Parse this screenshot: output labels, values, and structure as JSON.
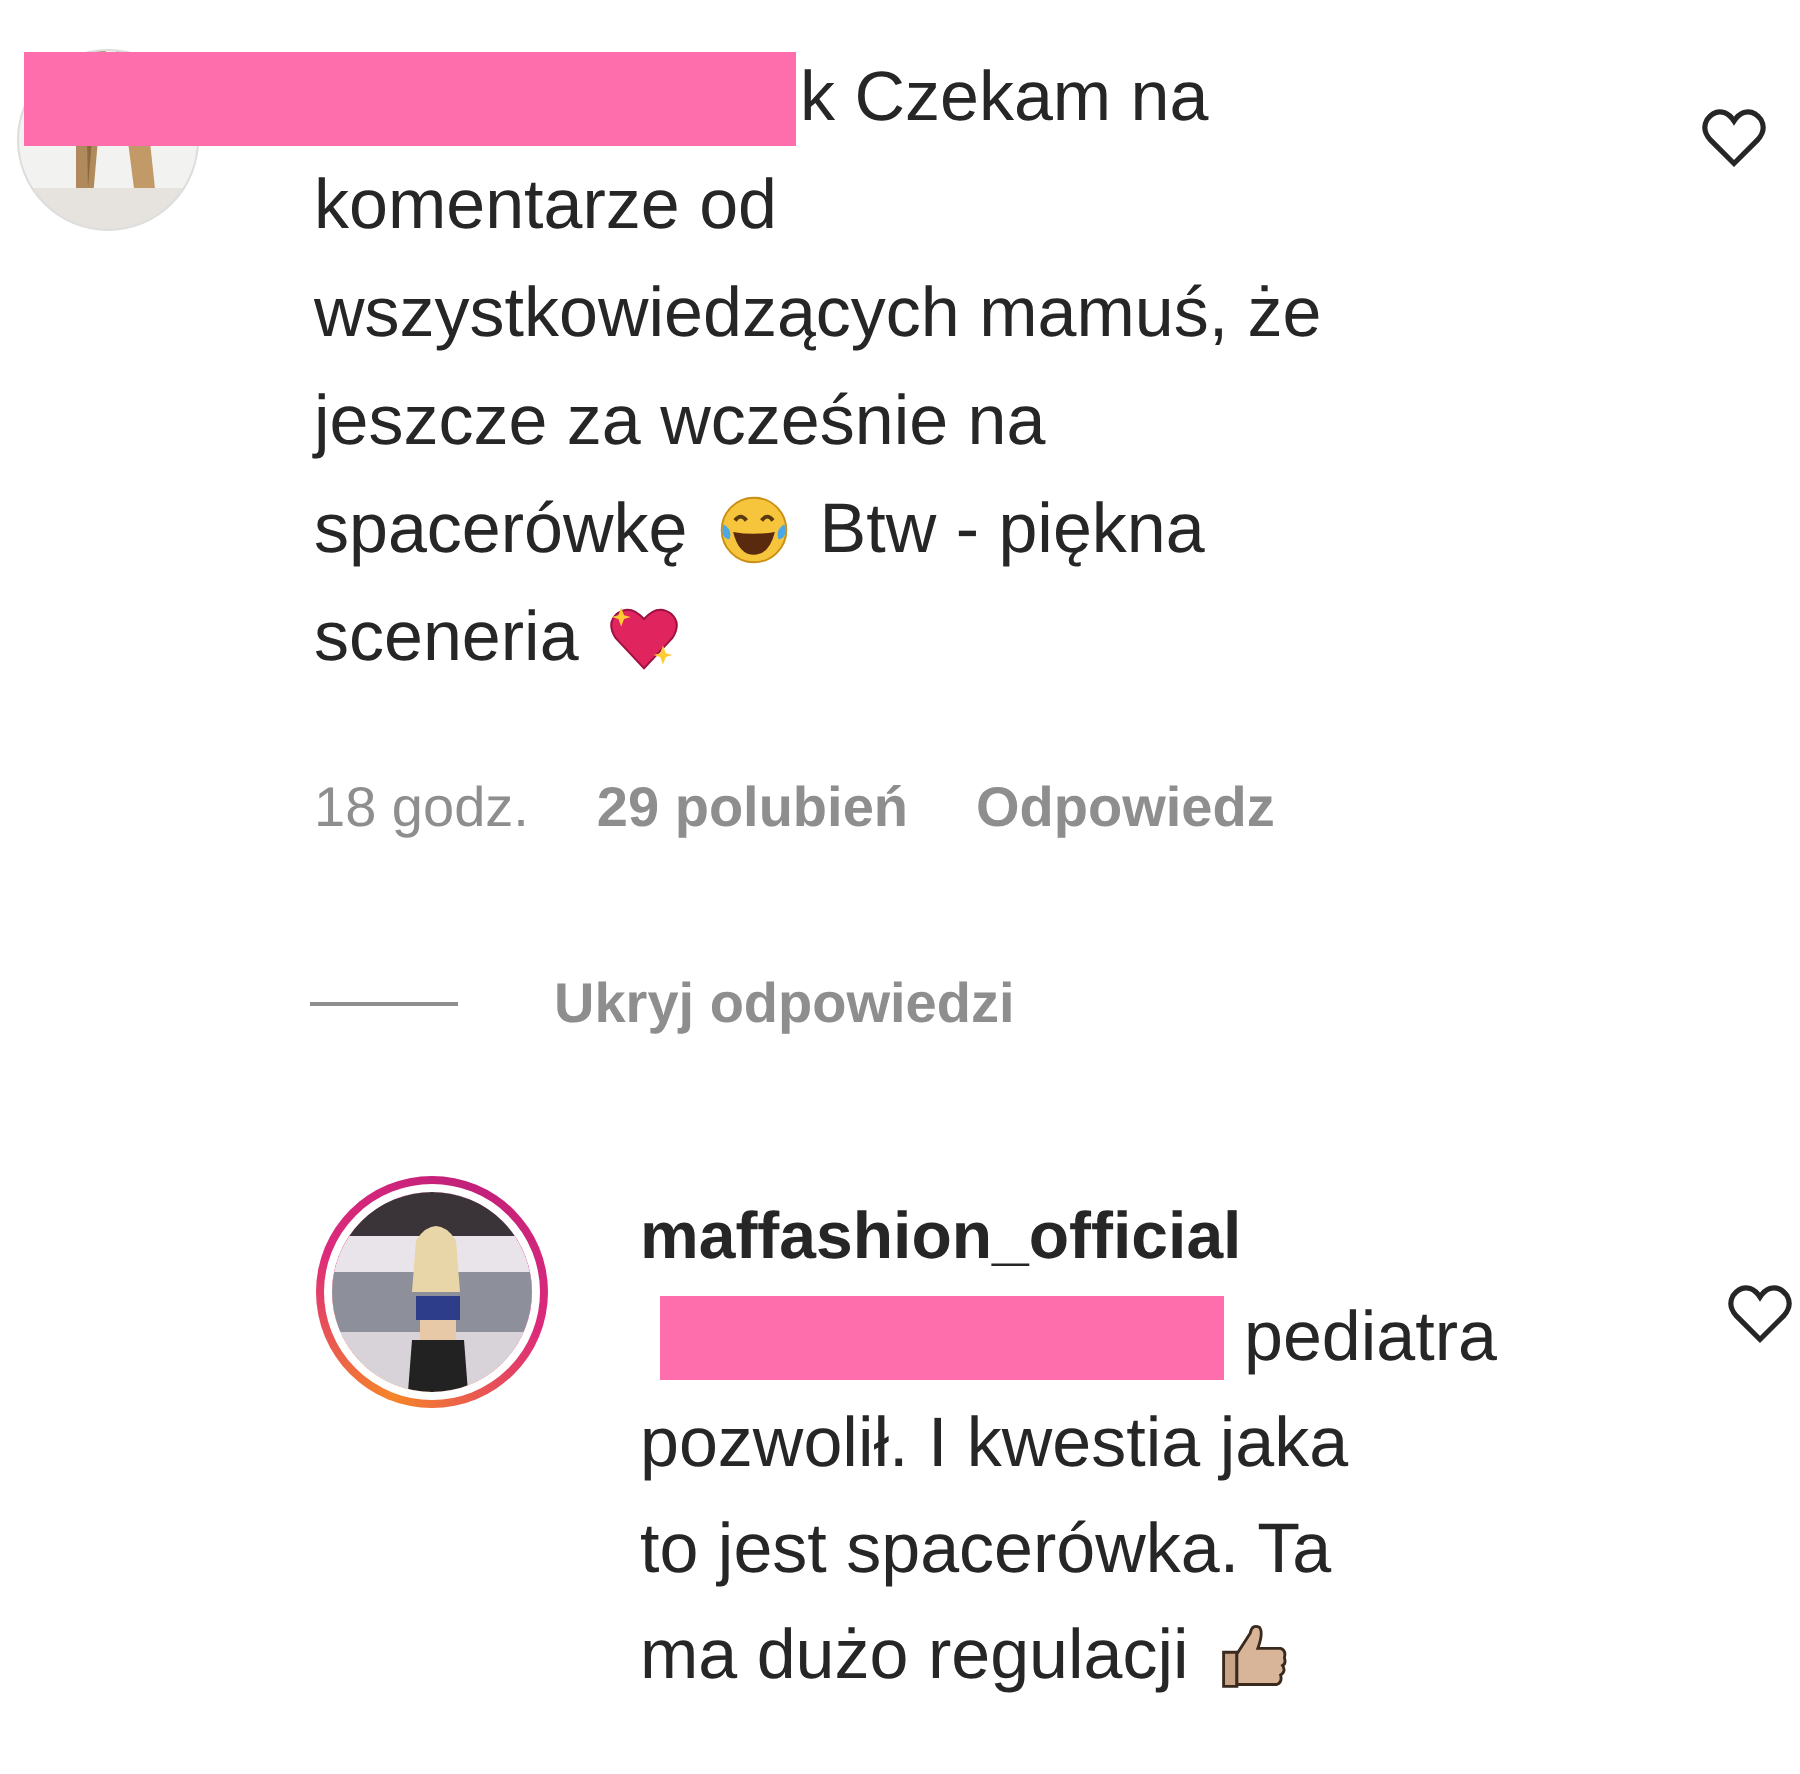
{
  "comments": [
    {
      "has_story": false,
      "liked": false,
      "lines": [
        [
          {
            "kind": "redaction"
          },
          {
            "kind": "text",
            "text": "k Czekam na"
          }
        ],
        [
          {
            "kind": "text",
            "text": "komentarze od"
          }
        ],
        [
          {
            "kind": "text",
            "text": "wszystkowiedzących mamuś, że"
          }
        ],
        [
          {
            "kind": "text",
            "text": "jeszcze za wcześnie na"
          }
        ],
        [
          {
            "kind": "text",
            "text": "spacerówkę"
          },
          {
            "kind": "laugh"
          },
          {
            "kind": "text",
            "text": "Btw - piękna"
          }
        ],
        [
          {
            "kind": "text",
            "text": "sceneria"
          },
          {
            "kind": "heart"
          }
        ]
      ],
      "meta": {
        "time": "18 godz.",
        "likes": "29 polubień",
        "reply": "Odpowiedz"
      },
      "toggle": "Ukryj odpowiedzi"
    },
    {
      "username": "maffashion_official",
      "has_story": true,
      "liked": false,
      "lines": [
        [
          {
            "kind": "redaction"
          },
          {
            "kind": "text",
            "text": "pediatra"
          }
        ],
        [
          {
            "kind": "text",
            "text": "pozwolił. I kwestia jaka"
          }
        ],
        [
          {
            "kind": "text",
            "text": "to jest spacerówka. Ta"
          }
        ],
        [
          {
            "kind": "text",
            "text": "ma dużo regulacji"
          },
          {
            "kind": "thumb"
          }
        ]
      ]
    }
  ]
}
